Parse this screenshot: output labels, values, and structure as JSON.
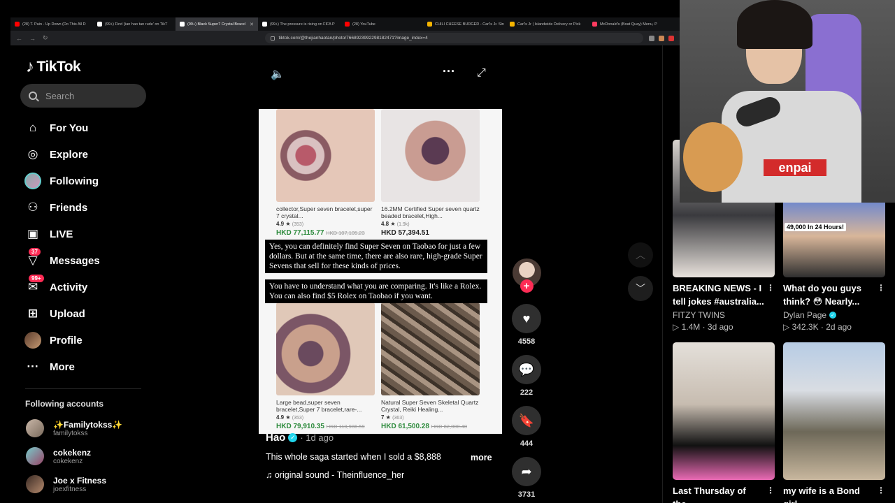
{
  "browser": {
    "tabs": [
      {
        "label": "(28) T. Pain - Up Down (Do This All D",
        "color": "#ff0000"
      },
      {
        "label": "(99+) Find 'jian hao tan rude' on TikT",
        "color": "#ffffff"
      },
      {
        "label": "(99+) Black Super7 Crystal Bracel",
        "color": "#ffffff",
        "active": true
      },
      {
        "label": "(99+) The pressure is rising on FIFA P",
        "color": "#ffffff"
      },
      {
        "label": "(28) YouTube",
        "color": "#ff0000"
      },
      {
        "label": "CHILI CHEESE BURGER - Carl's Jr. Sin",
        "color": "#f5b400"
      },
      {
        "label": "Carl's Jr | Islandwide Delivery or Pick",
        "color": "#f5b400"
      },
      {
        "label": "McDonald's (Boat Quay) Menu, P",
        "color": "#ff3b60"
      }
    ],
    "url": "tiktok.com/@thejianhaotan/photo/7668923992298182471?image_index=4"
  },
  "sidebar": {
    "logo": "TikTok",
    "search_placeholder": "Search",
    "items": [
      {
        "label": "For You",
        "icon": "home-icon",
        "glyph": "⌂"
      },
      {
        "label": "Explore",
        "icon": "compass-icon",
        "glyph": "◎"
      },
      {
        "label": "Following",
        "icon": "avatar-icon",
        "glyph": ""
      },
      {
        "label": "Friends",
        "icon": "friends-icon",
        "glyph": "⚇"
      },
      {
        "label": "LIVE",
        "icon": "live-icon",
        "glyph": "▣"
      },
      {
        "label": "Messages",
        "icon": "messages-icon",
        "glyph": "▽",
        "badge": "37"
      },
      {
        "label": "Activity",
        "icon": "activity-icon",
        "glyph": "✉",
        "badge": "99+"
      },
      {
        "label": "Upload",
        "icon": "upload-icon",
        "glyph": "⊞"
      },
      {
        "label": "Profile",
        "icon": "profile-icon",
        "glyph": ""
      },
      {
        "label": "More",
        "icon": "more-icon",
        "glyph": "···"
      }
    ],
    "following_title": "Following accounts",
    "following": [
      {
        "name": "✨Familytokss✨",
        "handle": "familytokss"
      },
      {
        "name": "cokekenz",
        "handle": "cokekenz"
      },
      {
        "name": "Joe x Fitness",
        "handle": "joexfitness"
      }
    ]
  },
  "post": {
    "products": [
      {
        "title": "collector,Super seven bracelet,super 7 crystal...",
        "rating": "4.9 ★",
        "reviews": "(353)",
        "price": "HKD 77,115.77",
        "old_price": "HKD 107,105.23"
      },
      {
        "title": "16.2MM Certified Super seven quartz beaded bracelet,High...",
        "rating": "4.8 ★",
        "reviews": "(1.9k)",
        "price": "HKD 57,394.51",
        "old_price": ""
      },
      {
        "title": "Large bead,super seven bracelet,Super 7 bracelet,rare-...",
        "rating": "4.9 ★",
        "reviews": "(353)",
        "price": "HKD 79,910.35",
        "old_price": "HKD 110,986.59"
      },
      {
        "title": "Natural Super Seven Skeletal Quartz Crystal, Reiki Healing...",
        "rating": "7 ★",
        "reviews": "(363)",
        "price": "HKD 61,500.28",
        "old_price": "HKD 82,000.40"
      }
    ],
    "subtitles": [
      "Yes, you can definitely find Super Seven on Taobao for just a few dollars. But at the same time, there are also rare, high-grade Super Sevens that sell for these kinds of prices.",
      "You have to understand what you are comparing. It's like a Rolex. You can also find $5 Rolex on Taobao if you want."
    ],
    "author": "Hao",
    "ago": "· 1d ago",
    "description": "This whole saga started when I sold a $8,888",
    "more": "more",
    "sound": "♫  original sound - Theinfluence_her",
    "likes": "4558",
    "comments": "222",
    "saves": "444",
    "shares": "3731"
  },
  "recommended": [
    {
      "title": "BREAKING NEWS - I tell jokes #australia...",
      "author": "FITZY TWINS",
      "verified": false,
      "stats": "▷ 1.4M · 3d ago",
      "overlay": ""
    },
    {
      "title": "What do you guys think? 😳 Nearly...",
      "author": "Dylan Page",
      "verified": true,
      "stats": "▷ 342.3K · 2d ago",
      "overlay": "49,000 In 24 Hours!"
    },
    {
      "title": "Last Thursday of the...",
      "author": "",
      "verified": false,
      "stats": "",
      "overlay": ""
    },
    {
      "title": "my wife is a Bond girl...",
      "author": "",
      "verified": false,
      "stats": "",
      "overlay": ""
    }
  ],
  "webcam": {
    "shirt_text": "enpai"
  }
}
